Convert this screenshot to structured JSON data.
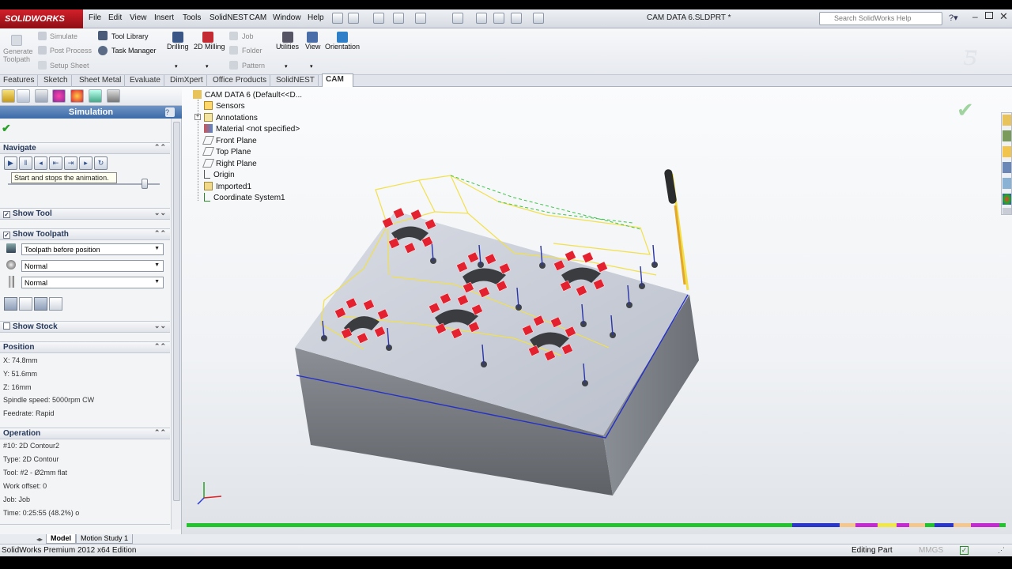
{
  "app": {
    "logo_text": "SOLIDWORKS",
    "menus": [
      "File",
      "Edit",
      "View",
      "Insert",
      "Tools",
      "SolidNEST",
      "CAM",
      "Window",
      "Help"
    ],
    "document_title": "CAM DATA 6.SLDPRT *",
    "search_placeholder": "Search SolidWorks Help"
  },
  "command_manager": {
    "generate_toolpath": "Generate Toolpath",
    "simulate": "Simulate",
    "post_process": "Post Process",
    "setup_sheet": "Setup Sheet",
    "tool_library": "Tool Library",
    "task_manager": "Task Manager",
    "drilling": "Drilling",
    "milling_2d": "2D Milling",
    "job": "Job",
    "folder": "Folder",
    "pattern": "Pattern",
    "utilities": "Utilities",
    "view": "View",
    "orientation": "Orientation"
  },
  "tabs": [
    "Features",
    "Sketch",
    "Sheet Metal",
    "Evaluate",
    "DimXpert",
    "Office Products",
    "SolidNEST",
    "CAM"
  ],
  "active_tab": "CAM",
  "panel": {
    "title": "Simulation",
    "help": "?",
    "navigate": {
      "label": "Navigate",
      "tooltip": "Start and stops the animation.",
      "buttons": [
        "play",
        "pause",
        "step-back",
        "step-back-op",
        "step-forward-op",
        "step-forward"
      ],
      "speed_level": 0.9
    },
    "show_tool": {
      "label": "Show Tool",
      "checked": true
    },
    "show_toolpath": {
      "label": "Show Toolpath",
      "checked": true,
      "toolpath_mode": "Toolpath before position",
      "tool_mode": "Normal",
      "holder_mode": "Normal"
    },
    "show_stock": {
      "label": "Show Stock",
      "checked": false
    },
    "position": {
      "label": "Position",
      "x": "X: 74.8mm",
      "y": "Y: 51.6mm",
      "z": "Z: 16mm",
      "spindle": "Spindle speed: 5000rpm CW",
      "feedrate": "Feedrate: Rapid"
    },
    "operation": {
      "label": "Operation",
      "number": "#10: 2D Contour2",
      "type": "Type: 2D Contour",
      "tool": "Tool: #2 - Ø2mm flat",
      "work_offset": "Work offset: 0",
      "job": "Job: Job",
      "time": "Time: 0:25:55 (48.2%) o"
    }
  },
  "tree": {
    "root": "CAM DATA 6  (Default<<D...",
    "items": [
      "Sensors",
      "Annotations",
      "Material <not specified>",
      "Front Plane",
      "Top Plane",
      "Right Plane",
      "Origin",
      "Imported1",
      "Coordinate System1"
    ]
  },
  "bottom_tabs": [
    "Model",
    "Motion Study 1"
  ],
  "status": {
    "edition": "SolidWorks Premium 2012 x64 Edition",
    "mode": "Editing Part",
    "units": "MMGS"
  },
  "colors": {
    "toolpath": "#f2e04a",
    "tool_marks": "#e3212f",
    "block_top": "#c5cad6",
    "block_side": "#707479",
    "accent_blue": "#3b6aa8",
    "timeline": "#22c32e"
  }
}
